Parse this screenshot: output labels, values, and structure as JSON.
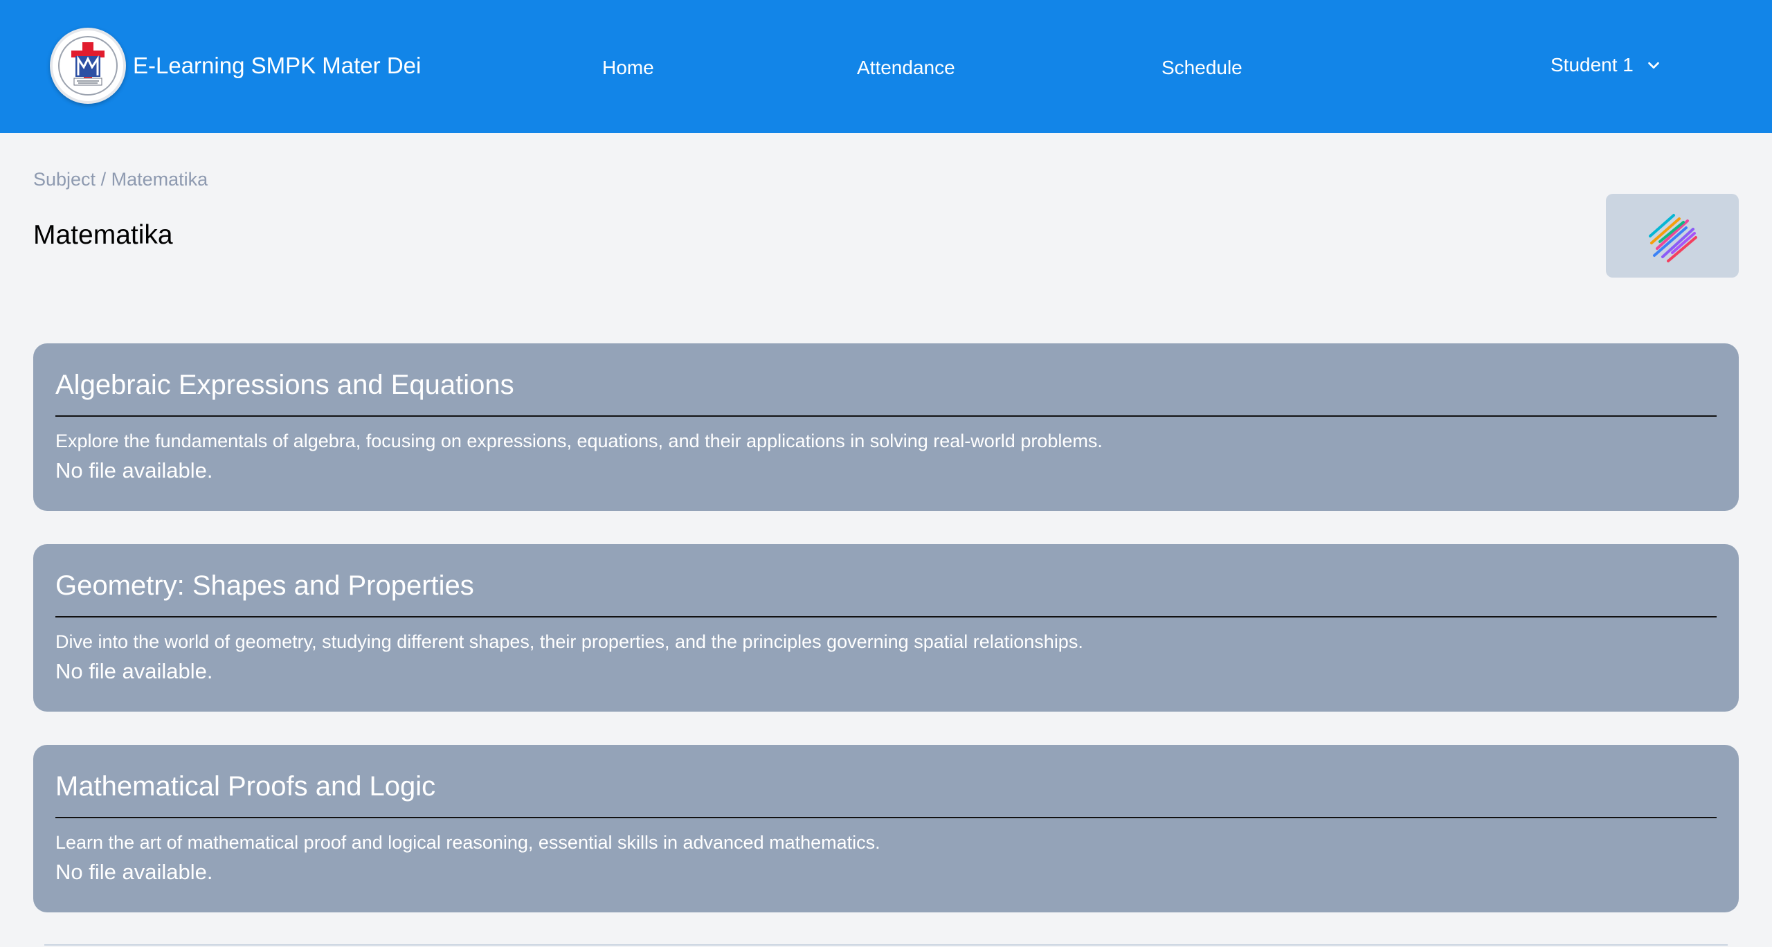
{
  "navbar": {
    "brand": "E-Learning SMPK Mater Dei",
    "links": [
      {
        "label": "Home"
      },
      {
        "label": "Attendance"
      },
      {
        "label": "Schedule"
      }
    ],
    "user": "Student 1"
  },
  "breadcrumb": {
    "root": "Subject",
    "separator": " / ",
    "current": "Matematika"
  },
  "page": {
    "title": "Matematika"
  },
  "materials": [
    {
      "title": "Algebraic Expressions and Equations",
      "description": "Explore the fundamentals of algebra, focusing on expressions, equations, and their applications in solving real-world problems.",
      "file": "No file available."
    },
    {
      "title": "Geometry: Shapes and Properties",
      "description": "Dive into the world of geometry, studying different shapes, their properties, and the principles governing spatial relationships.",
      "file": "No file available."
    },
    {
      "title": "Mathematical Proofs and Logic",
      "description": "Learn the art of mathematical proof and logical reasoning, essential skills in advanced mathematics.",
      "file": "No file available."
    }
  ],
  "colors": {
    "navbar": "#1285e8",
    "background": "#f3f4f6",
    "card": "#94a3b8",
    "thumb": "#cbd5e1"
  }
}
